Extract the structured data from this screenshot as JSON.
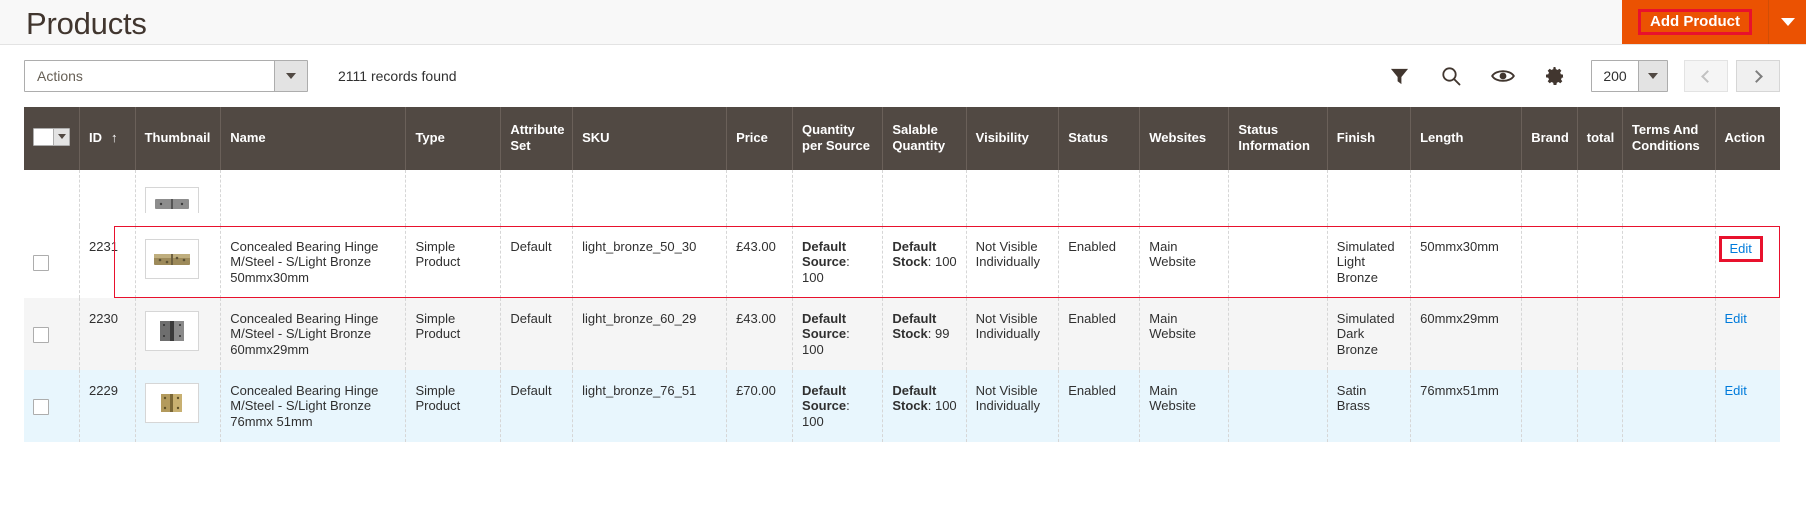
{
  "header": {
    "title": "Products",
    "add_product_label": "Add Product",
    "add_product_caret_icon": "chevron-down-icon"
  },
  "toolbar": {
    "actions_label": "Actions",
    "actions_caret_icon": "chevron-down-icon",
    "records_found": "2111 records found",
    "icons": [
      {
        "name": "filter-icon",
        "title": "Filters"
      },
      {
        "name": "search-icon",
        "title": "Search by keyword"
      },
      {
        "name": "eye-icon",
        "title": "Default View"
      },
      {
        "name": "gear-icon",
        "title": "Columns"
      }
    ],
    "per_page": "200",
    "per_page_caret_icon": "chevron-down-icon",
    "prev_label": "chevron-left-icon",
    "next_label": "chevron-right-icon"
  },
  "grid": {
    "select_all_caret_icon": "chevron-down-icon",
    "sort_arrow": "↑",
    "columns": [
      "",
      "ID",
      "Thumbnail",
      "Name",
      "Type",
      "Attribute Set",
      "SKU",
      "Price",
      "Quantity per Source",
      "Salable Quantity",
      "Visibility",
      "Status",
      "Websites",
      "Status Information",
      "Finish",
      "Length",
      "Brand",
      "total",
      "Terms And Conditions",
      "Action"
    ],
    "rows": [
      {
        "clipped": true,
        "stripe": "white",
        "id": "",
        "name": "",
        "type": "",
        "attribute_set": "",
        "sku": "",
        "price": "",
        "qty_source_label": "",
        "qty_source_value": "",
        "salable_label": "",
        "salable_value": "",
        "visibility": "",
        "status": "",
        "websites": "",
        "status_information": "",
        "finish": "",
        "length": "",
        "brand": "",
        "total": "",
        "terms": "",
        "action": ""
      },
      {
        "clipped": false,
        "stripe": "white",
        "focused": true,
        "id": "2231",
        "name": "Concealed Bearing Hinge M/Steel - S/Light Bronze 50mmx30mm",
        "type": "Simple Product",
        "attribute_set": "Default",
        "sku": "light_bronze_50_30",
        "price": "£43.00",
        "qty_source_label": "Default Source",
        "qty_source_value": "100",
        "salable_label": "Default Stock",
        "salable_value": "100",
        "visibility": "Not Visible Individually",
        "status": "Enabled",
        "websites": "Main Website",
        "status_information": "",
        "finish": "Simulated Light Bronze",
        "length": "50mmx30mm",
        "brand": "",
        "total": "",
        "terms": "",
        "action": "Edit"
      },
      {
        "clipped": false,
        "stripe": "grey",
        "focused": false,
        "id": "2230",
        "name": "Concealed Bearing Hinge M/Steel - S/Light Bronze 60mmx29mm",
        "type": "Simple Product",
        "attribute_set": "Default",
        "sku": "light_bronze_60_29",
        "price": "£43.00",
        "qty_source_label": "Default Source",
        "qty_source_value": "100",
        "salable_label": "Default Stock",
        "salable_value": "99",
        "salable_inline": true,
        "visibility": "Not Visible Individually",
        "status": "Enabled",
        "websites": "Main Website",
        "status_information": "",
        "finish": "Simulated Dark Bronze",
        "length": "60mmx29mm",
        "brand": "",
        "total": "",
        "terms": "",
        "action": "Edit"
      },
      {
        "clipped": false,
        "stripe": "blue",
        "focused": false,
        "id": "2229",
        "name": "Concealed Bearing Hinge M/Steel - S/Light Bronze 76mmx 51mm",
        "type": "Simple Product",
        "attribute_set": "Default",
        "sku": "light_bronze_76_51",
        "price": "£70.00",
        "qty_source_label": "Default Source",
        "qty_source_value": "100",
        "salable_label": "Default Stock",
        "salable_value": "100",
        "visibility": "Not Visible Individually",
        "status": "Enabled",
        "websites": "Main Website",
        "status_information": "",
        "finish": "Satin Brass",
        "length": "76mmx51mm",
        "brand": "",
        "total": "",
        "terms": "",
        "action": "Edit"
      }
    ]
  },
  "colors": {
    "accent_orange": "#eb5202",
    "header_dark": "#514943",
    "link_blue": "#007bdb",
    "highlight_red": "#e8112d",
    "row_blue": "#e8f6fd"
  }
}
